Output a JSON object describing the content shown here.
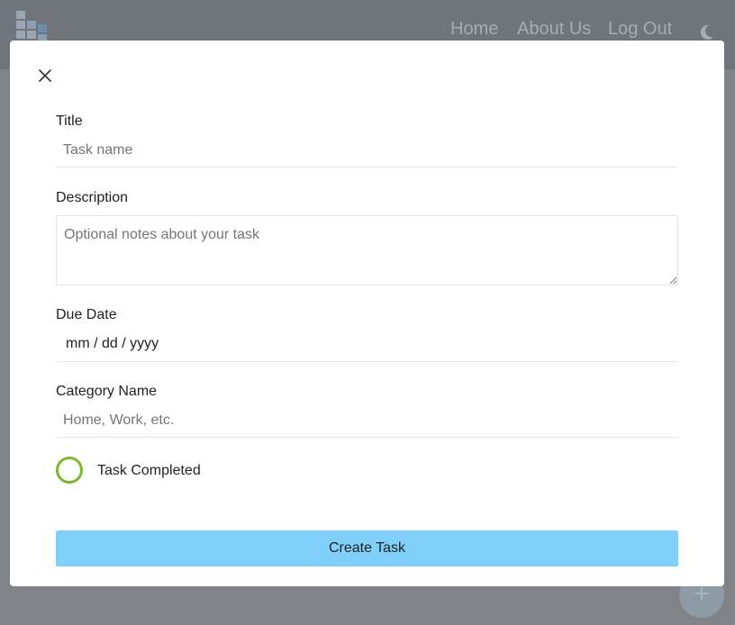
{
  "navbar": {
    "logo_icon": "stacked-blocks-logo",
    "links": [
      {
        "label": "Home"
      },
      {
        "label": "About Us"
      },
      {
        "label": "Log Out"
      }
    ],
    "theme_toggle_icon": "moon-icon"
  },
  "modal": {
    "close_icon": "close-icon",
    "fields": {
      "title": {
        "label": "Title",
        "placeholder": "Task name",
        "value": ""
      },
      "description": {
        "label": "Description",
        "placeholder": "Optional notes about your task",
        "value": ""
      },
      "due_date": {
        "label": "Due Date",
        "value": "mm / dd / yyyy"
      },
      "category": {
        "label": "Category Name",
        "placeholder": "Home, Work, etc.",
        "value": ""
      }
    },
    "completed": {
      "label": "Task Completed",
      "checked": false
    },
    "submit_label": "Create Task"
  },
  "fab": {
    "icon": "plus-icon",
    "label": "+"
  },
  "colors": {
    "accent_button": "#81cffb",
    "checkbox_ring": "#7cb82f",
    "navbar": "#70747b",
    "overlay": "#7f8287"
  }
}
